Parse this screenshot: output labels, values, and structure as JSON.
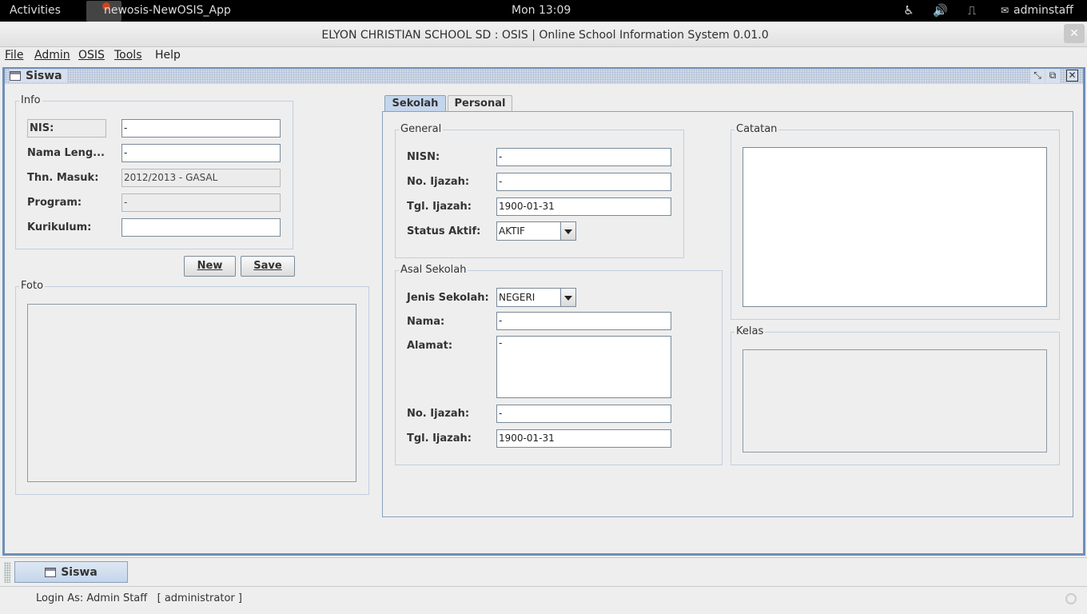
{
  "topbar": {
    "activities": "Activities",
    "app_title": "newosis-NewOSIS_App",
    "clock": "Mon 13:09",
    "user": "adminstaff",
    "icons": [
      "accessibility-icon",
      "volume-icon",
      "network-icon",
      "user-icon"
    ]
  },
  "window": {
    "title": "ELYON CHRISTIAN SCHOOL SD : OSIS | Online School Information System 0.01.0",
    "close_glyph": "✕"
  },
  "menu": {
    "file": "File",
    "admin": "Admin",
    "osis": "OSIS",
    "tools": "Tools",
    "help": "Help"
  },
  "frame": {
    "title": "Siswa"
  },
  "info": {
    "legend": "Info",
    "nis_label": "NIS:",
    "nis_value": "-",
    "nama_label": "Nama Leng...",
    "nama_value": "-",
    "thn_label": "Thn. Masuk:",
    "thn_value": "2012/2013 - GASAL",
    "program_label": "Program:",
    "program_value": "-",
    "kurikulum_label": "Kurikulum:",
    "kurikulum_value": "",
    "new_button": "New",
    "save_button": "Save"
  },
  "foto": {
    "legend": "Foto"
  },
  "tabs": {
    "sekolah": "Sekolah",
    "personal": "Personal",
    "selected": "Sekolah"
  },
  "general": {
    "legend": "General",
    "nisn_label": "NISN:",
    "nisn_value": "-",
    "no_ijazah_label": "No. Ijazah:",
    "no_ijazah_value": "-",
    "tgl_ijazah_label": "Tgl. Ijazah:",
    "tgl_ijazah_value": "1900-01-31",
    "status_label": "Status Aktif:",
    "status_value": "AKTIF"
  },
  "asal": {
    "legend": "Asal Sekolah",
    "jenis_label": "Jenis Sekolah:",
    "jenis_value": "NEGERI",
    "nama_label": "Nama:",
    "nama_value": "-",
    "alamat_label": "Alamat:",
    "alamat_value": "-",
    "no_ijazah_label": "No. Ijazah:",
    "no_ijazah_value": "-",
    "tgl_ijazah_label": "Tgl. Ijazah:",
    "tgl_ijazah_value": "1900-01-31"
  },
  "catatan": {
    "legend": "Catatan"
  },
  "kelas": {
    "legend": "Kelas"
  },
  "taskbar": {
    "task_label": "Siswa"
  },
  "status": {
    "login": "Login As: Admin Staff   [ administrator ]"
  }
}
